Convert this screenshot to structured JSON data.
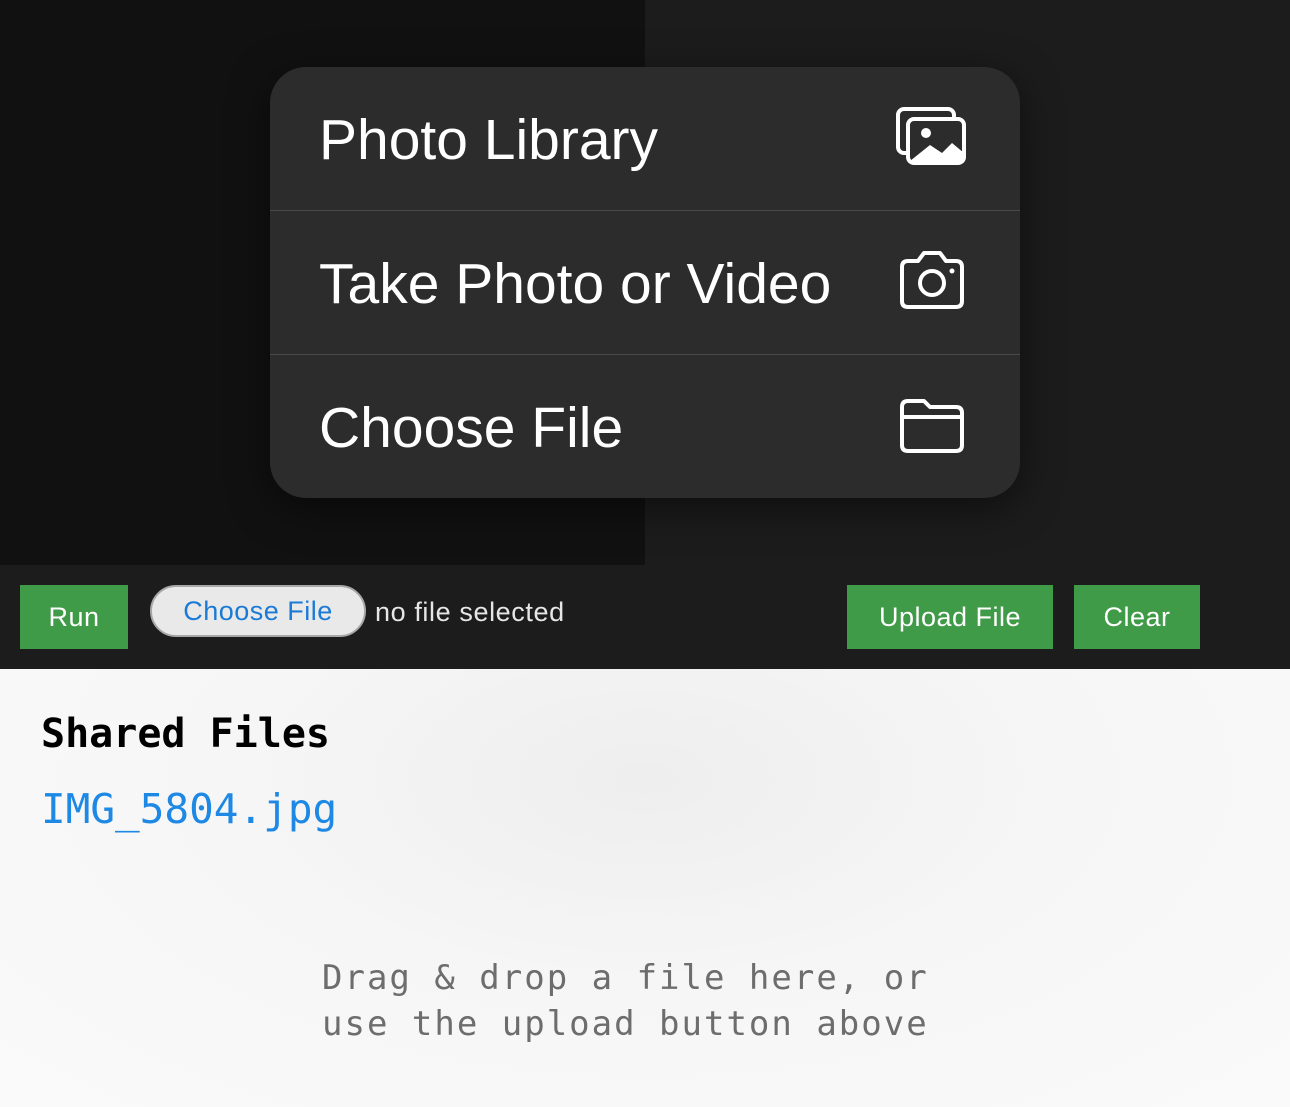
{
  "menu": {
    "items": [
      {
        "label": "Photo Library",
        "icon": "photo-library-icon"
      },
      {
        "label": "Take Photo or Video",
        "icon": "camera-icon"
      },
      {
        "label": "Choose File",
        "icon": "folder-icon"
      }
    ]
  },
  "toolbar": {
    "run_label": "Run",
    "choose_file_label": "Choose File",
    "no_file_text": "no file selected",
    "upload_label": "Upload File",
    "clear_label": "Clear"
  },
  "shared": {
    "title": "Shared Files",
    "files": [
      "IMG_5804.jpg"
    ],
    "drop_hint_line1": "Drag & drop a file here, or",
    "drop_hint_line2": "use the upload button above"
  },
  "colors": {
    "accent_green": "#3f9b47",
    "link_blue": "#1e88e5",
    "menu_bg": "#2c2c2c"
  }
}
